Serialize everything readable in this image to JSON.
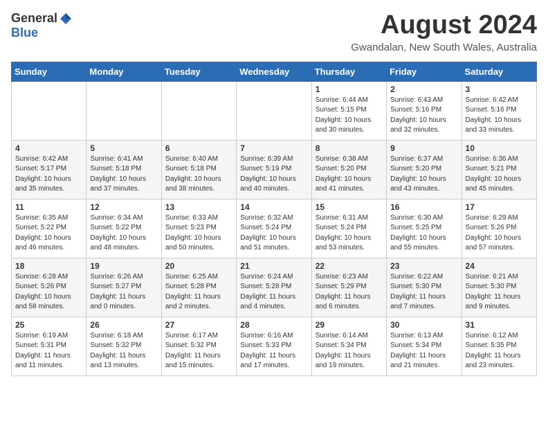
{
  "header": {
    "logo_general": "General",
    "logo_blue": "Blue",
    "month_title": "August 2024",
    "subtitle": "Gwandalan, New South Wales, Australia"
  },
  "days_of_week": [
    "Sunday",
    "Monday",
    "Tuesday",
    "Wednesday",
    "Thursday",
    "Friday",
    "Saturday"
  ],
  "weeks": [
    [
      {
        "day": "",
        "sunrise": "",
        "sunset": "",
        "daylight": ""
      },
      {
        "day": "",
        "sunrise": "",
        "sunset": "",
        "daylight": ""
      },
      {
        "day": "",
        "sunrise": "",
        "sunset": "",
        "daylight": ""
      },
      {
        "day": "",
        "sunrise": "",
        "sunset": "",
        "daylight": ""
      },
      {
        "day": "1",
        "sunrise": "Sunrise: 6:44 AM",
        "sunset": "Sunset: 5:15 PM",
        "daylight": "Daylight: 10 hours and 30 minutes."
      },
      {
        "day": "2",
        "sunrise": "Sunrise: 6:43 AM",
        "sunset": "Sunset: 5:16 PM",
        "daylight": "Daylight: 10 hours and 32 minutes."
      },
      {
        "day": "3",
        "sunrise": "Sunrise: 6:42 AM",
        "sunset": "Sunset: 5:16 PM",
        "daylight": "Daylight: 10 hours and 33 minutes."
      }
    ],
    [
      {
        "day": "4",
        "sunrise": "Sunrise: 6:42 AM",
        "sunset": "Sunset: 5:17 PM",
        "daylight": "Daylight: 10 hours and 35 minutes."
      },
      {
        "day": "5",
        "sunrise": "Sunrise: 6:41 AM",
        "sunset": "Sunset: 5:18 PM",
        "daylight": "Daylight: 10 hours and 37 minutes."
      },
      {
        "day": "6",
        "sunrise": "Sunrise: 6:40 AM",
        "sunset": "Sunset: 5:18 PM",
        "daylight": "Daylight: 10 hours and 38 minutes."
      },
      {
        "day": "7",
        "sunrise": "Sunrise: 6:39 AM",
        "sunset": "Sunset: 5:19 PM",
        "daylight": "Daylight: 10 hours and 40 minutes."
      },
      {
        "day": "8",
        "sunrise": "Sunrise: 6:38 AM",
        "sunset": "Sunset: 5:20 PM",
        "daylight": "Daylight: 10 hours and 41 minutes."
      },
      {
        "day": "9",
        "sunrise": "Sunrise: 6:37 AM",
        "sunset": "Sunset: 5:20 PM",
        "daylight": "Daylight: 10 hours and 43 minutes."
      },
      {
        "day": "10",
        "sunrise": "Sunrise: 6:36 AM",
        "sunset": "Sunset: 5:21 PM",
        "daylight": "Daylight: 10 hours and 45 minutes."
      }
    ],
    [
      {
        "day": "11",
        "sunrise": "Sunrise: 6:35 AM",
        "sunset": "Sunset: 5:22 PM",
        "daylight": "Daylight: 10 hours and 46 minutes."
      },
      {
        "day": "12",
        "sunrise": "Sunrise: 6:34 AM",
        "sunset": "Sunset: 5:22 PM",
        "daylight": "Daylight: 10 hours and 48 minutes."
      },
      {
        "day": "13",
        "sunrise": "Sunrise: 6:33 AM",
        "sunset": "Sunset: 5:23 PM",
        "daylight": "Daylight: 10 hours and 50 minutes."
      },
      {
        "day": "14",
        "sunrise": "Sunrise: 6:32 AM",
        "sunset": "Sunset: 5:24 PM",
        "daylight": "Daylight: 10 hours and 51 minutes."
      },
      {
        "day": "15",
        "sunrise": "Sunrise: 6:31 AM",
        "sunset": "Sunset: 5:24 PM",
        "daylight": "Daylight: 10 hours and 53 minutes."
      },
      {
        "day": "16",
        "sunrise": "Sunrise: 6:30 AM",
        "sunset": "Sunset: 5:25 PM",
        "daylight": "Daylight: 10 hours and 55 minutes."
      },
      {
        "day": "17",
        "sunrise": "Sunrise: 6:29 AM",
        "sunset": "Sunset: 5:26 PM",
        "daylight": "Daylight: 10 hours and 57 minutes."
      }
    ],
    [
      {
        "day": "18",
        "sunrise": "Sunrise: 6:28 AM",
        "sunset": "Sunset: 5:26 PM",
        "daylight": "Daylight: 10 hours and 58 minutes."
      },
      {
        "day": "19",
        "sunrise": "Sunrise: 6:26 AM",
        "sunset": "Sunset: 5:27 PM",
        "daylight": "Daylight: 11 hours and 0 minutes."
      },
      {
        "day": "20",
        "sunrise": "Sunrise: 6:25 AM",
        "sunset": "Sunset: 5:28 PM",
        "daylight": "Daylight: 11 hours and 2 minutes."
      },
      {
        "day": "21",
        "sunrise": "Sunrise: 6:24 AM",
        "sunset": "Sunset: 5:28 PM",
        "daylight": "Daylight: 11 hours and 4 minutes."
      },
      {
        "day": "22",
        "sunrise": "Sunrise: 6:23 AM",
        "sunset": "Sunset: 5:29 PM",
        "daylight": "Daylight: 11 hours and 6 minutes."
      },
      {
        "day": "23",
        "sunrise": "Sunrise: 6:22 AM",
        "sunset": "Sunset: 5:30 PM",
        "daylight": "Daylight: 11 hours and 7 minutes."
      },
      {
        "day": "24",
        "sunrise": "Sunrise: 6:21 AM",
        "sunset": "Sunset: 5:30 PM",
        "daylight": "Daylight: 11 hours and 9 minutes."
      }
    ],
    [
      {
        "day": "25",
        "sunrise": "Sunrise: 6:19 AM",
        "sunset": "Sunset: 5:31 PM",
        "daylight": "Daylight: 11 hours and 11 minutes."
      },
      {
        "day": "26",
        "sunrise": "Sunrise: 6:18 AM",
        "sunset": "Sunset: 5:32 PM",
        "daylight": "Daylight: 11 hours and 13 minutes."
      },
      {
        "day": "27",
        "sunrise": "Sunrise: 6:17 AM",
        "sunset": "Sunset: 5:32 PM",
        "daylight": "Daylight: 11 hours and 15 minutes."
      },
      {
        "day": "28",
        "sunrise": "Sunrise: 6:16 AM",
        "sunset": "Sunset: 5:33 PM",
        "daylight": "Daylight: 11 hours and 17 minutes."
      },
      {
        "day": "29",
        "sunrise": "Sunrise: 6:14 AM",
        "sunset": "Sunset: 5:34 PM",
        "daylight": "Daylight: 11 hours and 19 minutes."
      },
      {
        "day": "30",
        "sunrise": "Sunrise: 6:13 AM",
        "sunset": "Sunset: 5:34 PM",
        "daylight": "Daylight: 11 hours and 21 minutes."
      },
      {
        "day": "31",
        "sunrise": "Sunrise: 6:12 AM",
        "sunset": "Sunset: 5:35 PM",
        "daylight": "Daylight: 11 hours and 23 minutes."
      }
    ]
  ]
}
